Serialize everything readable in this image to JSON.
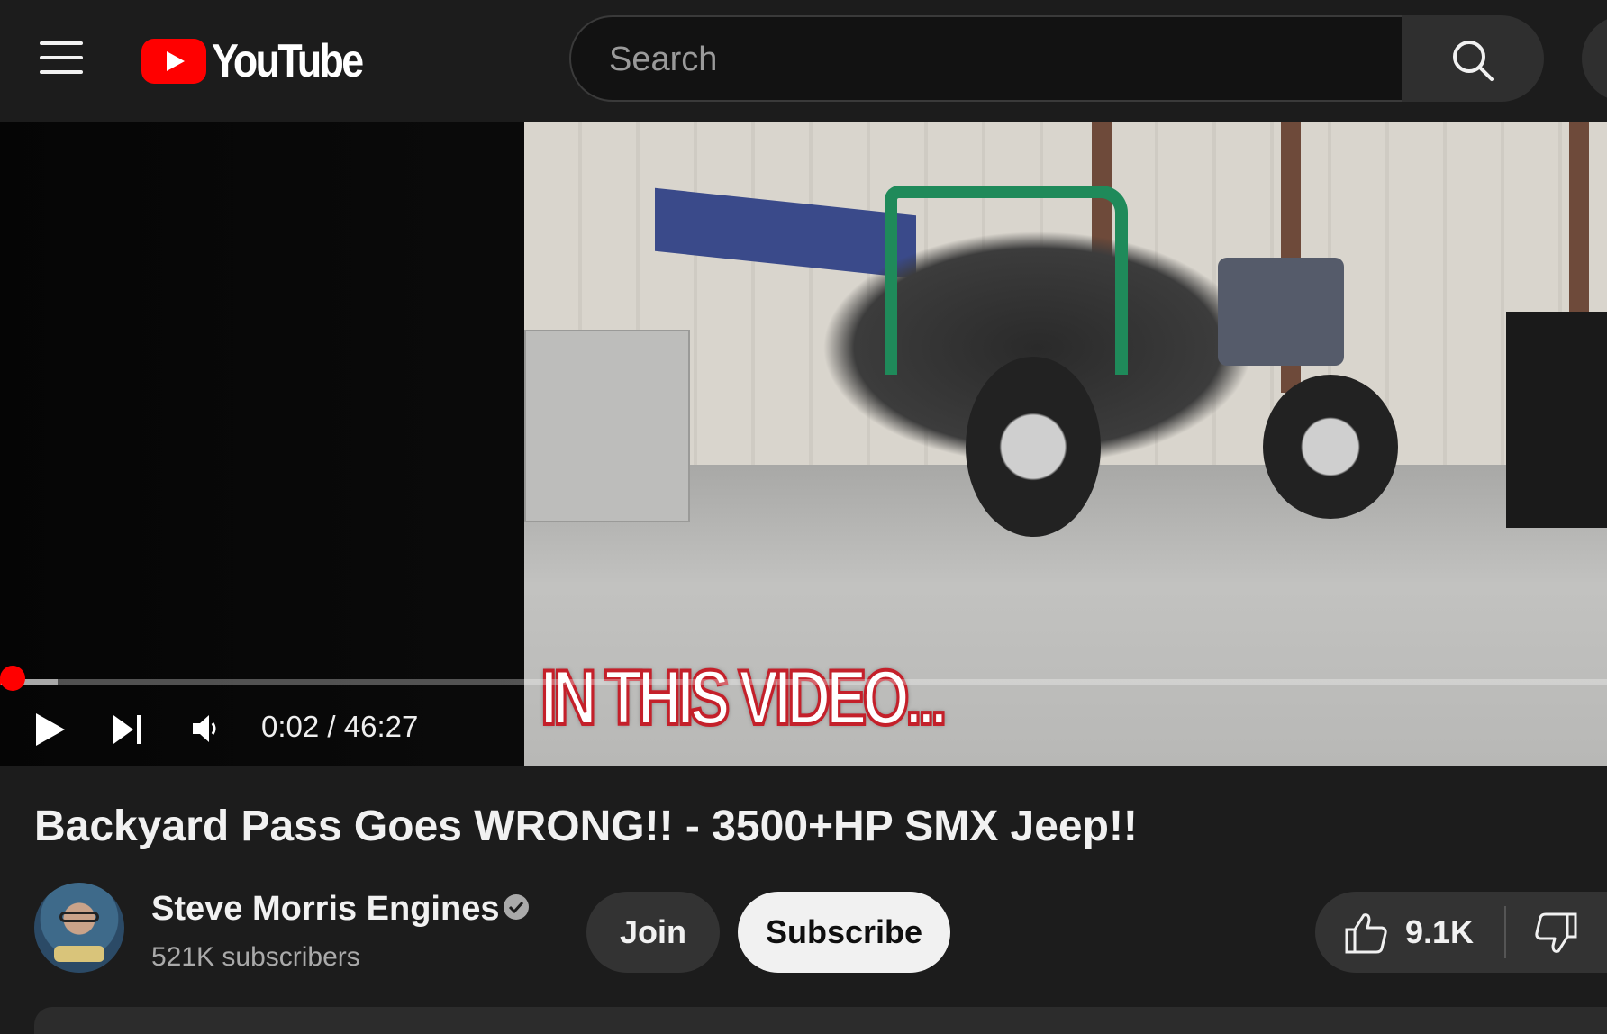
{
  "header": {
    "logo_text": "YouTube",
    "search_placeholder": "Search"
  },
  "player": {
    "overlay_caption": "IN THIS VIDEO...",
    "current_time": "0:02",
    "duration": "46:27",
    "time_display": "0:02 / 46:27",
    "progress_fraction": 0.0007
  },
  "video": {
    "title": "Backyard Pass Goes WRONG!! - 3500+HP SMX Jeep!!"
  },
  "channel": {
    "name": "Steve Morris Engines",
    "subscribers": "521K subscribers",
    "join_label": "Join",
    "subscribe_label": "Subscribe"
  },
  "actions": {
    "like_count": "9.1K"
  },
  "colors": {
    "background": "#1c1c1c",
    "brand_red": "#ff0000",
    "button_dark": "#333333",
    "button_light": "#f1f1f1"
  },
  "icons": [
    "menu-icon",
    "youtube-logo-icon",
    "search-icon",
    "play-icon",
    "next-icon",
    "volume-icon",
    "verified-icon",
    "thumbs-up-icon",
    "thumbs-down-icon"
  ]
}
